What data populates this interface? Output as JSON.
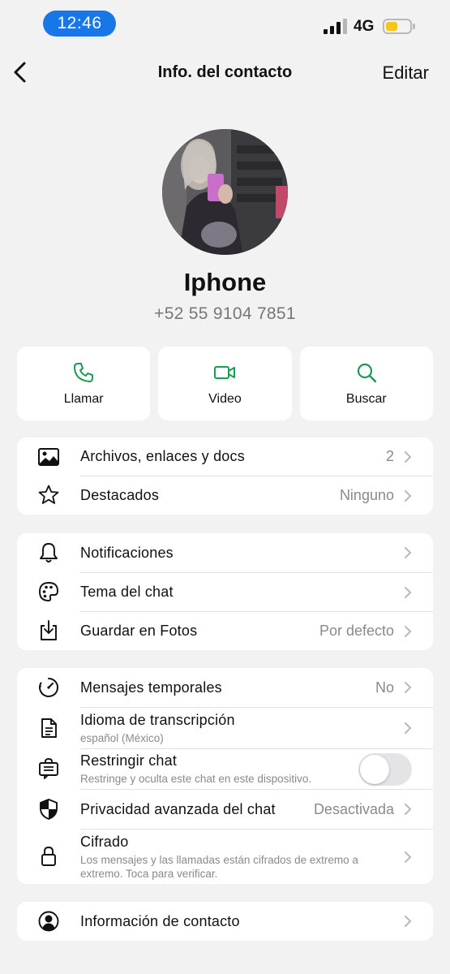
{
  "status_bar": {
    "time": "12:46",
    "network": "4G",
    "battery_level": 0.5,
    "battery_color": "#f5c518"
  },
  "nav": {
    "title": "Info. del contacto",
    "edit_label": "Editar"
  },
  "contact": {
    "name": "Iphone",
    "phone": "+52 55 9104 7851"
  },
  "actions": [
    {
      "label": "Llamar",
      "icon": "phone-icon"
    },
    {
      "label": "Video",
      "icon": "video-icon"
    },
    {
      "label": "Buscar",
      "icon": "search-icon"
    }
  ],
  "accent_color": "#1d9a53",
  "group1": [
    {
      "label": "Archivos, enlaces y docs",
      "value": "2",
      "icon": "image-icon"
    },
    {
      "label": "Destacados",
      "value": "Ninguno",
      "icon": "star-icon"
    }
  ],
  "group2": [
    {
      "label": "Notificaciones",
      "value": "",
      "icon": "bell-icon"
    },
    {
      "label": "Tema del chat",
      "value": "",
      "icon": "palette-icon"
    },
    {
      "label": "Guardar en Fotos",
      "value": "Por defecto",
      "icon": "save-download-icon"
    }
  ],
  "group3": [
    {
      "label": "Mensajes temporales",
      "value": "No",
      "icon": "timer-icon"
    },
    {
      "label": "Idioma de transcripción",
      "sub": "español (México)",
      "icon": "document-icon"
    },
    {
      "label": "Restringir chat",
      "sub": "Restringe y oculta este chat en este dispositivo.",
      "toggle": false,
      "icon": "restrict-chat-icon"
    },
    {
      "label": "Privacidad avanzada del chat",
      "value": "Desactivada",
      "icon": "shield-icon"
    },
    {
      "label": "Cifrado",
      "sub": "Los mensajes y las llamadas están cifrados de extremo a extremo. Toca para verificar.",
      "icon": "lock-icon"
    }
  ],
  "group4": [
    {
      "label": "Información de contacto",
      "icon": "person-circle-icon"
    }
  ]
}
